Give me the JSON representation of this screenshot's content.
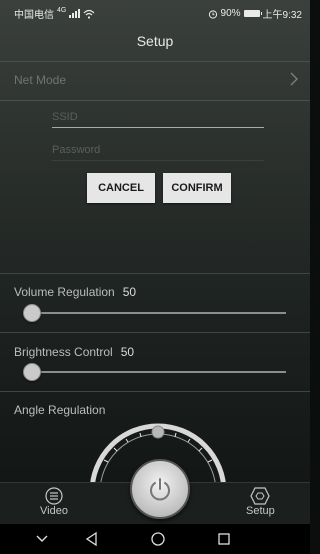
{
  "status_bar": {
    "carrier": "中国电信",
    "network": "4G",
    "battery": "90%",
    "time": "上午9:32"
  },
  "header": {
    "title": "Setup"
  },
  "net_mode": {
    "label": "Net Mode"
  },
  "wifi_form": {
    "ssid_placeholder": "SSID",
    "password_placeholder": "Password",
    "cancel_label": "CANCEL",
    "confirm_label": "CONFIRM"
  },
  "volume": {
    "label": "Volume Regulation",
    "value": "50",
    "level": 0
  },
  "brightness": {
    "label": "Brightness Control",
    "value": "50",
    "level": 0
  },
  "angle": {
    "label": "Angle Regulation"
  },
  "bottom_nav": {
    "video_label": "Video",
    "setup_label": "Setup"
  },
  "icons": [
    "wifi-icon",
    "alarm-icon",
    "battery-icon",
    "chevron-right-icon",
    "video-menu-icon",
    "power-icon",
    "setup-hexagon-icon",
    "nav-down-icon",
    "nav-back-icon",
    "nav-home-icon",
    "nav-recents-icon"
  ],
  "colors": {
    "background": "#2a2f2c",
    "button": "#e6e6e6",
    "track": "#8a8f8c"
  }
}
